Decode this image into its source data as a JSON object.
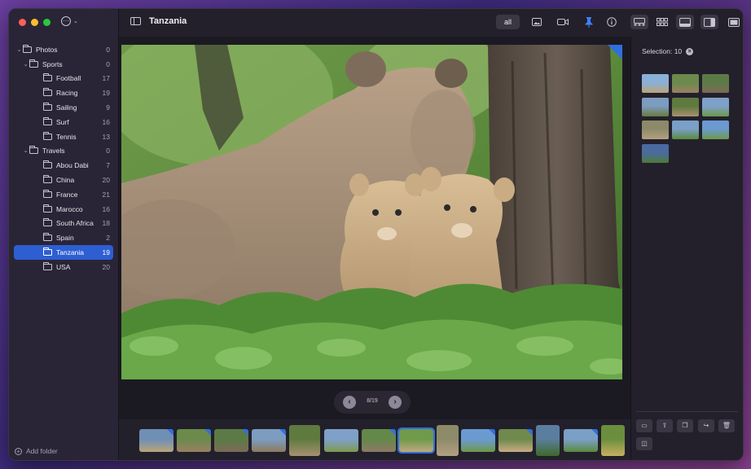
{
  "window": {
    "title": "Tanzania"
  },
  "sidebar": {
    "items": [
      {
        "label": "Photos",
        "count": "0",
        "level": 0,
        "chevron": "v"
      },
      {
        "label": "Sports",
        "count": "0",
        "level": 1,
        "chevron": "v"
      },
      {
        "label": "Football",
        "count": "17",
        "level": 2
      },
      {
        "label": "Racing",
        "count": "19",
        "level": 2
      },
      {
        "label": "Sailing",
        "count": "9",
        "level": 2
      },
      {
        "label": "Surf",
        "count": "16",
        "level": 2
      },
      {
        "label": "Tennis",
        "count": "13",
        "level": 2
      },
      {
        "label": "Travels",
        "count": "0",
        "level": 1,
        "chevron": "v"
      },
      {
        "label": "Abou Dabi",
        "count": "7",
        "level": 2
      },
      {
        "label": "China",
        "count": "20",
        "level": 2
      },
      {
        "label": "France",
        "count": "21",
        "level": 2
      },
      {
        "label": "Marocco",
        "count": "16",
        "level": 2
      },
      {
        "label": "South Africa",
        "count": "18",
        "level": 2
      },
      {
        "label": "Spain",
        "count": "2",
        "level": 2
      },
      {
        "label": "Tanzania",
        "count": "19",
        "level": 2,
        "selected": true
      },
      {
        "label": "USA",
        "count": "20",
        "level": 2
      }
    ],
    "add_folder_label": "Add folder"
  },
  "toolbar": {
    "filter_all": "all"
  },
  "viewer": {
    "position": "8/19"
  },
  "selection": {
    "label": "Selection: 10"
  },
  "colors": {
    "accent": "#2d5fd3",
    "marker": "#2f6fe0"
  }
}
